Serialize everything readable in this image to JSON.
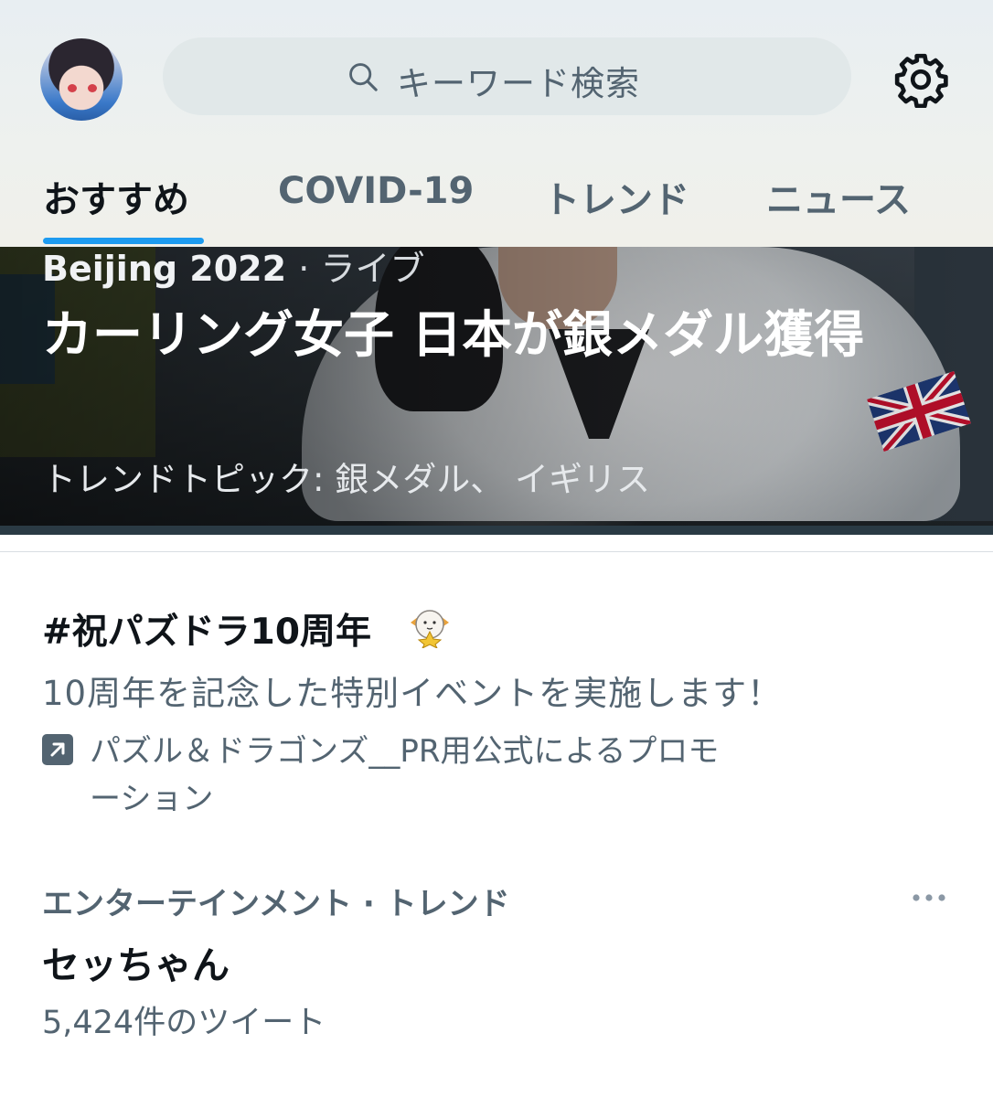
{
  "header": {
    "search_placeholder": "キーワード検索"
  },
  "tabs": [
    {
      "label": "おすすめ",
      "active": true
    },
    {
      "label": "COVID-19",
      "active": false
    },
    {
      "label": "トレンド",
      "active": false
    },
    {
      "label": "ニュース",
      "active": false
    }
  ],
  "hero": {
    "event": "Beijing 2022",
    "category": "· ライブ",
    "headline": "カーリング女子 日本が銀メダル獲得",
    "topics": "トレンドトピック: 銀メダル、 イギリス"
  },
  "promoted": {
    "title": "#祝パズドラ10周年",
    "description": "10周年を記念した特別イベントを実施します！",
    "promoted_by": "パズル＆ドラゴンズ__PR用公式によるプロモーション"
  },
  "trend": {
    "meta": "エンターテインメント · トレンド",
    "name": "セッちゃん",
    "count": "5,424件のツイート"
  },
  "colors": {
    "accent": "#1d9bf0",
    "text_primary": "#0f1419",
    "text_secondary": "#536471"
  },
  "icons": [
    "avatar",
    "search-icon",
    "gear-icon",
    "promoted-icon",
    "more-icon"
  ]
}
